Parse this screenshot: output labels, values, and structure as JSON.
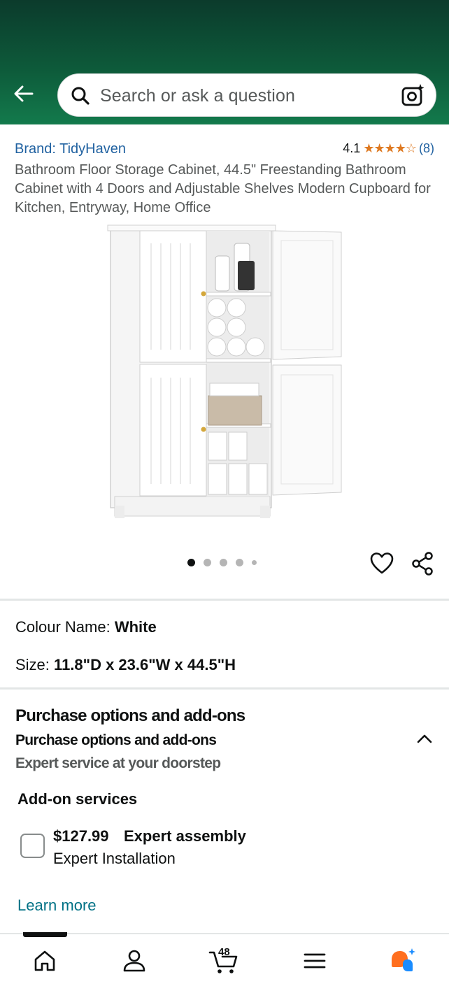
{
  "search": {
    "placeholder": "Search or ask a question"
  },
  "product": {
    "brand": "Brand: TidyHaven",
    "rating": "4.1",
    "stars": "★★★★☆",
    "review_count": "(8)",
    "title": "Bathroom Floor Storage Cabinet, 44.5\" Freestanding Bathroom Cabinet with 4 Doors and Adjustable Shelves Modern Cupboard for Kitchen, Entryway, Home Office"
  },
  "gallery": {
    "image_count": 5,
    "active_index": 0
  },
  "variations": {
    "colour_label": "Colour Name:",
    "colour_value": "White",
    "size_label": "Size:",
    "size_value": "11.8\"D x 23.6\"W x 44.5\"H"
  },
  "purchase_options": {
    "heading": "Purchase options and add-ons",
    "subheading": "Purchase options and add-ons",
    "description": "Expert service at your doorstep",
    "addon_title": "Add-on services",
    "addon_price": "$127.99",
    "addon_name": "Expert assembly",
    "addon_sub": "Expert Installation",
    "learn_more": "Learn more"
  },
  "bottom_nav": {
    "items": [
      "home-icon",
      "account-icon",
      "cart-icon",
      "menu-icon",
      "rufus-icon"
    ],
    "cart_count": "48"
  },
  "colors": {
    "header_dark": "#0c3b2c",
    "header_light": "#137a4c",
    "link": "#2162a1",
    "star": "#de7921",
    "rufus_orange": "#ff6f1f",
    "rufus_blue": "#1a8cff"
  }
}
